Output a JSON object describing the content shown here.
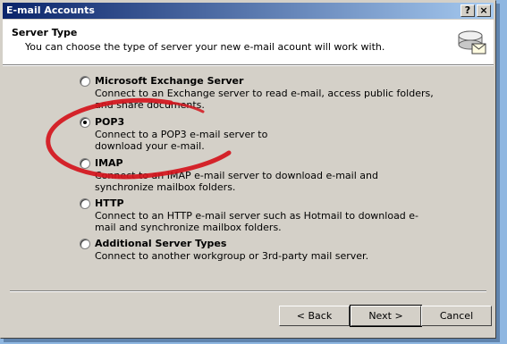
{
  "window": {
    "title": "E-mail Accounts",
    "help_button": "?",
    "close_button": "×"
  },
  "header": {
    "title": "Server Type",
    "subtitle": "You can choose the type of server your new e-mail acount will work with.",
    "icon": "email-accounts-icon"
  },
  "options": [
    {
      "label": "Microsoft Exchange Server",
      "description": "Connect to an Exchange server to read e-mail, access public folders, and share documents.",
      "selected": false
    },
    {
      "label": "POP3",
      "description": "Connect to a POP3 e-mail server to download your e-mail.",
      "selected": true
    },
    {
      "label": "IMAP",
      "description": "Connect to an IMAP e-mail server to download e-mail and synchronize mailbox folders.",
      "selected": false
    },
    {
      "label": "HTTP",
      "description": "Connect to an HTTP e-mail server such as Hotmail to download e-mail and synchronize mailbox folders.",
      "selected": false
    },
    {
      "label": "Additional Server Types",
      "description": "Connect to another workgroup or 3rd-party mail server.",
      "selected": false
    }
  ],
  "buttons": {
    "back": "< Back",
    "next": "Next >",
    "cancel": "Cancel"
  },
  "colors": {
    "titlebar_start": "#0a246a",
    "titlebar_end": "#a6caf0",
    "annotation_circle": "#d4141c"
  }
}
